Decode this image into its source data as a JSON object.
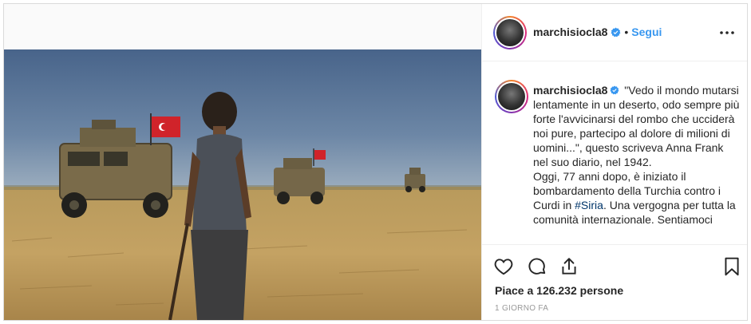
{
  "post": {
    "author": {
      "username": "marchisiocla8",
      "follow_label": "Segui",
      "dot": "•"
    },
    "caption": {
      "username": "marchisiocla8",
      "text_part1": "\"Vedo il mondo mutarsi lentamente in un deserto, odo sempre più forte l'avvicinarsi del rombo che ucciderà noi pure, partecipo al dolore di milioni di uomini...\", questo scriveva Anna Frank nel suo diario, nel 1942.",
      "text_part2": "Oggi, 77 anni dopo, è iniziato il bombardamento della Turchia contro i Curdi in ",
      "hashtag": "#Siria",
      "text_part3": ". Una vergogna per tutta la comunità internazionale. Sentiamoci"
    },
    "likes_text": "Piace a 126.232 persone",
    "timestamp": "1 GIORNO FA"
  },
  "colors": {
    "accent": "#3897f0",
    "hashtag": "#003569",
    "border": "#dbdbdb",
    "muted": "#999999",
    "text": "#262626"
  },
  "icons": [
    "verified-badge-icon",
    "more-options-icon",
    "heart-icon",
    "comment-icon",
    "share-icon",
    "bookmark-icon"
  ]
}
